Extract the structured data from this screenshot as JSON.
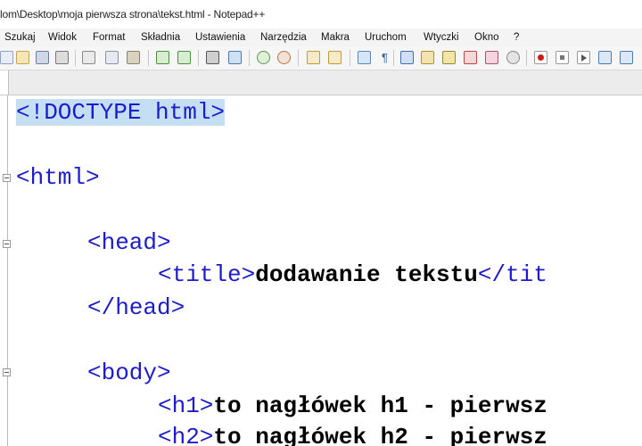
{
  "window": {
    "title": "lom\\Desktop\\moja pierwsza strona\\tekst.html - Notepad++"
  },
  "menu": {
    "items": [
      "Szukaj",
      "Widok",
      "Format",
      "Składnia",
      "Ustawienia",
      "Narzędzia",
      "Makra",
      "Uruchom",
      "Wtyczki",
      "Okno",
      "?"
    ]
  },
  "toolbar": {
    "icons": [
      "new-file",
      "open-file",
      "save",
      "print",
      "cut",
      "copy",
      "paste",
      "undo",
      "redo",
      "find",
      "replace",
      "zoom-in",
      "zoom-out",
      "sync-v",
      "sync-h",
      "word-wrap",
      "all-chars",
      "indent-guide",
      "udl",
      "doc-map",
      "function-list",
      "folder-workspace",
      "monitor",
      "record-macro",
      "stop-record",
      "play-macro",
      "run-macro-multiple",
      "save-macro"
    ]
  },
  "editor": {
    "lines": [
      {
        "tag_open": "<!DOCTYPE html>",
        "text": "",
        "tag_close": ""
      },
      {
        "tag_open": "<html>",
        "text": "",
        "tag_close": ""
      },
      {
        "tag_open": "<head>",
        "text": "",
        "tag_close": ""
      },
      {
        "tag_open": "<title>",
        "text": "dodawanie tekstu",
        "tag_close": "</tit"
      },
      {
        "tag_open": "</head>",
        "text": "",
        "tag_close": ""
      },
      {
        "tag_open": "<body>",
        "text": "",
        "tag_close": ""
      },
      {
        "tag_open": "<h1>",
        "text": "to nagłówek h1 - pierwsz",
        "tag_close": ""
      },
      {
        "tag_open": "<h2>",
        "text": "to nagłówek h2 - pierwsz",
        "tag_close": ""
      }
    ]
  },
  "colors": {
    "tag": "#1c1ccc",
    "text": "#000000",
    "highlight": "#c4dff3"
  }
}
